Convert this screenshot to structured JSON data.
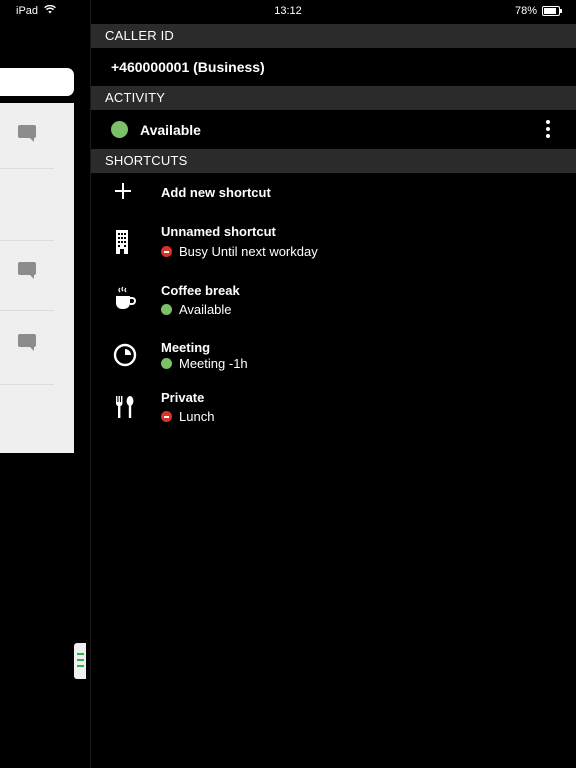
{
  "status_bar": {
    "device": "iPad",
    "time": "13:12",
    "battery": "78%"
  },
  "caller_id": {
    "header": "CALLER ID",
    "value": "+460000001 (Business)"
  },
  "activity": {
    "header": "ACTIVITY",
    "status": "Available",
    "status_color": "#7cc06a"
  },
  "shortcuts": {
    "header": "SHORTCUTS",
    "add_label": "Add new shortcut",
    "items": [
      {
        "title": "Unnamed shortcut",
        "status": "Busy Until next workday",
        "status_kind": "busy",
        "icon": "building-icon"
      },
      {
        "title": "Coffee break",
        "status": "Available",
        "status_kind": "available",
        "icon": "coffee-cup-icon"
      },
      {
        "title": "Meeting",
        "status": "Meeting -1h",
        "status_kind": "available",
        "icon": "clock-icon"
      },
      {
        "title": "Private",
        "status": "Lunch",
        "status_kind": "busy",
        "icon": "fork-spoon-icon"
      }
    ]
  },
  "colors": {
    "available": "#7cc06a",
    "busy": "#d9342b",
    "section_header_bg": "#2b2b2b"
  }
}
